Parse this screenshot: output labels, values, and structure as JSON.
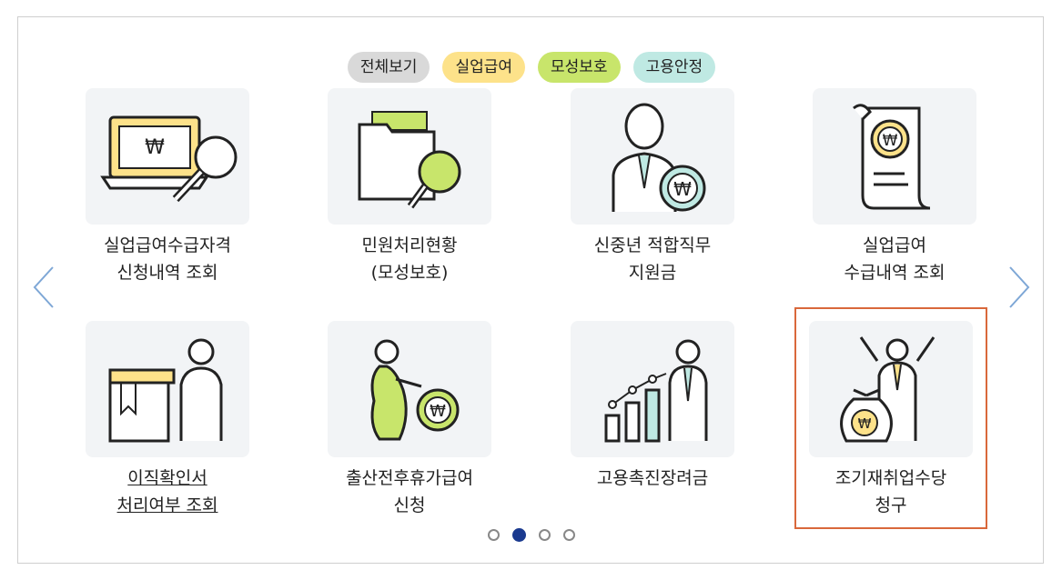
{
  "colors": {
    "accent_selected_border": "#d9683b",
    "active_dot": "#1a3a8f",
    "chip_all": "#d9d9d9",
    "chip_unemployment": "#fde28a",
    "chip_maternity": "#c8e56b",
    "chip_employment": "#bfe9e3"
  },
  "filters": [
    {
      "label": "전체보기",
      "color": "#d9d9d9"
    },
    {
      "label": "실업급여",
      "color": "#fde28a"
    },
    {
      "label": "모성보호",
      "color": "#c8e56b"
    },
    {
      "label": "고용안정",
      "color": "#bfe9e3"
    }
  ],
  "navigation": {
    "prev_icon": "chevron-left-icon",
    "next_icon": "chevron-right-icon"
  },
  "tiles": [
    {
      "icon": "laptop-magnifier-icon",
      "line1": "실업급여수급자격",
      "line2": "신청내역 조회"
    },
    {
      "icon": "folder-magnifier-icon",
      "line1": "민원처리현황",
      "line2": "(모성보호)"
    },
    {
      "icon": "senior-worker-coin-icon",
      "line1": "신중년 적합직무",
      "line2": "지원금"
    },
    {
      "icon": "won-document-icon",
      "line1": "실업급여",
      "line2": "수급내역 조회"
    },
    {
      "icon": "book-person-icon",
      "line1": "이직확인서",
      "line2": "처리여부 조회"
    },
    {
      "icon": "pregnant-woman-coin-icon",
      "line1": "출산전후휴가급여",
      "line2": "신청"
    },
    {
      "icon": "growth-chart-person-icon",
      "line1": "고용촉진장려금",
      "line2": ""
    },
    {
      "icon": "celebrating-person-moneybag-icon",
      "line1": "조기재취업수당",
      "line2": "청구"
    }
  ],
  "pagination": {
    "count": 4,
    "active_index": 1
  }
}
